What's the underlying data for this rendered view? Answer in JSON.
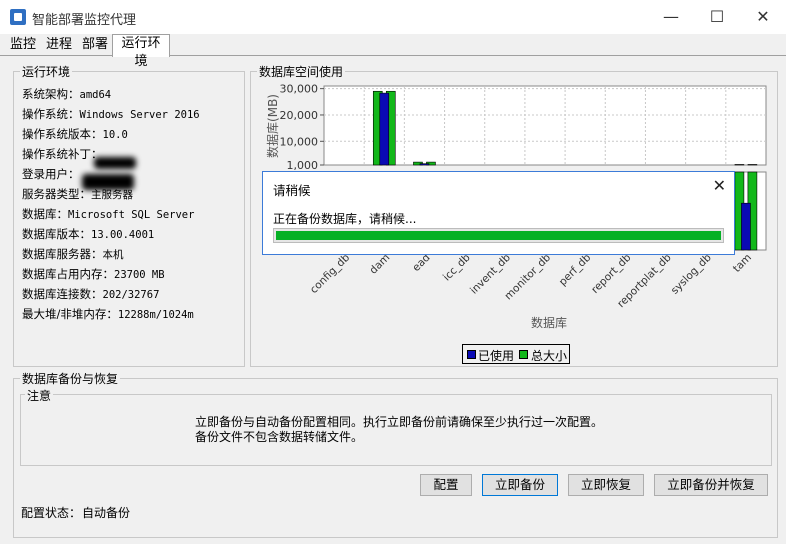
{
  "window": {
    "title": "智能部署监控代理",
    "minimize": "—",
    "maximize": "☐",
    "close": "✕"
  },
  "tabs": [
    "监控",
    "进程",
    "部署",
    "运行环境"
  ],
  "env": {
    "legend": "运行环境",
    "lines": [
      {
        "label": "系统架构：",
        "value": "amd64"
      },
      {
        "label": "操作系统：",
        "value": "Windows Server 2016"
      },
      {
        "label": "操作系统版本：",
        "value": "10.0"
      },
      {
        "label": "操作系统补丁：",
        "value": ""
      },
      {
        "label": "登录用户：",
        "value": ""
      },
      {
        "label": "服务器类型：",
        "value": "主服务器"
      },
      {
        "label": "数据库：",
        "value": "Microsoft SQL Server"
      },
      {
        "label": "数据库版本：",
        "value": "13.00.4001"
      },
      {
        "label": "数据库服务器：",
        "value": "本机"
      },
      {
        "label": "数据库占用内存：",
        "value": "23700 MB"
      },
      {
        "label": "数据库连接数：",
        "value": "202/32767"
      },
      {
        "label": "最大堆/非堆内存：",
        "value": "12288m/1024m"
      }
    ]
  },
  "space": {
    "legend": "数据库空间使用",
    "legend_used": "已使用",
    "legend_total": "总大小"
  },
  "chart_data": {
    "type": "bar",
    "ylabel": "数据库(MB)",
    "xlabel": "数据库",
    "categories": [
      "config_db",
      "dam",
      "ead",
      "icc_db",
      "invent_db",
      "monitor_db",
      "perf_db",
      "report_db",
      "reportplat_db",
      "syslog_db",
      "tam"
    ],
    "series": [
      {
        "name": "已使用",
        "values": [
          0,
          28300,
          1500,
          0,
          0,
          0,
          0,
          0,
          0,
          0,
          600
        ]
      },
      {
        "name": "总大小",
        "values": [
          0,
          29000,
          2100,
          0,
          0,
          0,
          0,
          0,
          0,
          0,
          1200
        ]
      }
    ],
    "yticks": [
      1000,
      10000,
      20000,
      30000
    ],
    "ytick_labels": [
      "1,000",
      "10,000",
      "20,000",
      "30,000"
    ],
    "ylim": [
      1000,
      31000
    ],
    "colors": {
      "used": "#0a0ab4",
      "total": "#12b81a"
    }
  },
  "dialog": {
    "title": "请稍候",
    "close": "✕",
    "message": "正在备份数据库，请稍候...",
    "progress": 1.0
  },
  "backup": {
    "legend": "数据库备份与恢复",
    "note_legend": "注意",
    "note_line1": "立即备份与自动备份配置相同。执行立即备份前请确保至少执行过一次配置。",
    "note_line2": "备份文件不包含数据转储文件。",
    "buttons": {
      "config": "配置",
      "backup_now": "立即备份",
      "restore_now": "立即恢复",
      "backup_restore": "立即备份并恢复"
    },
    "status_label": "配置状态：",
    "status_value": "自动备份"
  }
}
